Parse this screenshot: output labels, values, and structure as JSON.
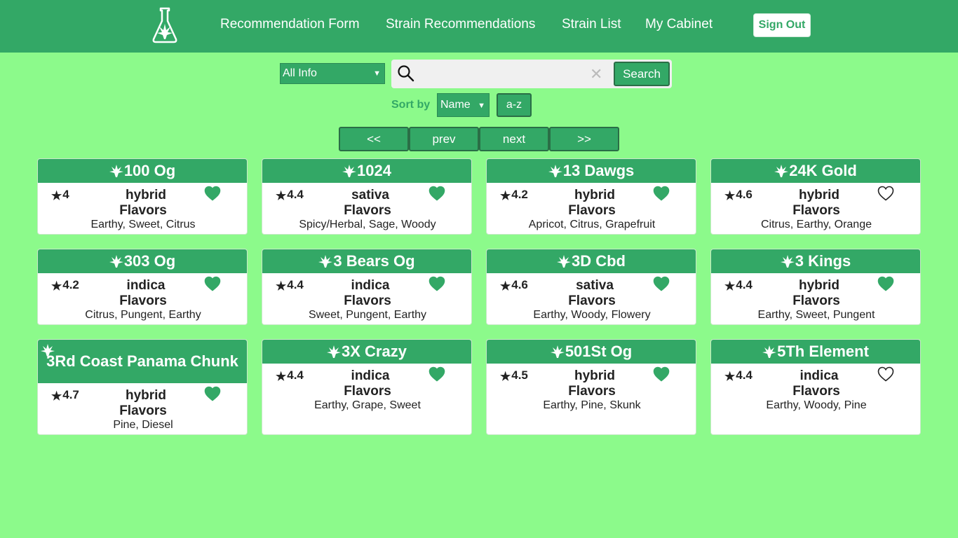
{
  "nav": {
    "links": [
      "Recommendation Form",
      "Strain Recommendations",
      "Strain List",
      "My Cabinet"
    ],
    "signout": "Sign Out"
  },
  "search": {
    "filter_value": "All Info",
    "placeholder": "",
    "button": "Search"
  },
  "sort": {
    "label": "Sort by",
    "value": "Name",
    "order": "a-z"
  },
  "pagination": [
    "<<",
    "prev",
    "next",
    ">>"
  ],
  "colors": {
    "brand": "#33a866",
    "background": "#8cfa8b"
  },
  "icons": {
    "logo": "flask-leaf-icon",
    "leaf": "cannabis-leaf-icon",
    "favorite": "heart-icon",
    "rating": "star-icon",
    "search": "search-icon",
    "clear": "close-icon"
  },
  "strains": [
    {
      "name": "100 Og",
      "rating": "4",
      "type": "hybrid",
      "flavors_label": "Flavors",
      "flavors": "Earthy, Sweet, Citrus",
      "favorited": true
    },
    {
      "name": "1024",
      "rating": "4.4",
      "type": "sativa",
      "flavors_label": "Flavors",
      "flavors": "Spicy/Herbal, Sage, Woody",
      "favorited": true
    },
    {
      "name": "13 Dawgs",
      "rating": "4.2",
      "type": "hybrid",
      "flavors_label": "Flavors",
      "flavors": "Apricot, Citrus, Grapefruit",
      "favorited": true
    },
    {
      "name": "24K Gold",
      "rating": "4.6",
      "type": "hybrid",
      "flavors_label": "Flavors",
      "flavors": "Citrus, Earthy, Orange",
      "favorited": false
    },
    {
      "name": "303 Og",
      "rating": "4.2",
      "type": "indica",
      "flavors_label": "Flavors",
      "flavors": "Citrus, Pungent, Earthy",
      "favorited": true
    },
    {
      "name": "3 Bears Og",
      "rating": "4.4",
      "type": "indica",
      "flavors_label": "Flavors",
      "flavors": "Sweet, Pungent, Earthy",
      "favorited": true
    },
    {
      "name": "3D Cbd",
      "rating": "4.6",
      "type": "sativa",
      "flavors_label": "Flavors",
      "flavors": "Earthy, Woody, Flowery",
      "favorited": true
    },
    {
      "name": "3 Kings",
      "rating": "4.4",
      "type": "hybrid",
      "flavors_label": "Flavors",
      "flavors": "Earthy, Sweet, Pungent",
      "favorited": true
    },
    {
      "name": "3Rd Coast Panama Chunk",
      "rating": "4.7",
      "type": "hybrid",
      "flavors_label": "Flavors",
      "flavors": "Pine, Diesel",
      "favorited": true
    },
    {
      "name": "3X Crazy",
      "rating": "4.4",
      "type": "indica",
      "flavors_label": "Flavors",
      "flavors": "Earthy, Grape, Sweet",
      "favorited": true
    },
    {
      "name": "501St Og",
      "rating": "4.5",
      "type": "hybrid",
      "flavors_label": "Flavors",
      "flavors": "Earthy, Pine, Skunk",
      "favorited": true
    },
    {
      "name": "5Th Element",
      "rating": "4.4",
      "type": "indica",
      "flavors_label": "Flavors",
      "flavors": "Earthy, Woody, Pine",
      "favorited": false
    }
  ]
}
